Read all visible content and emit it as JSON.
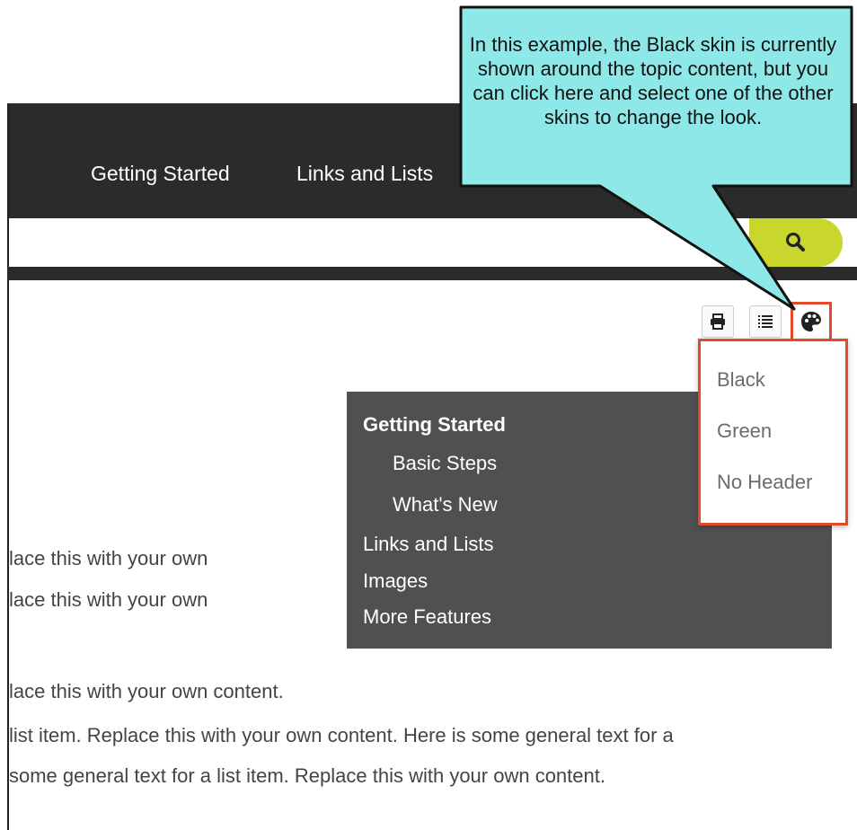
{
  "callout": {
    "text": "In this example, the Black skin is currently shown around the topic content, but you can click here and select one of the other skins to change the look."
  },
  "nav": {
    "links": [
      "Getting Started",
      "Links and Lists"
    ]
  },
  "search": {
    "placeholder": "",
    "button_icon": "search-icon",
    "accent_color": "#c8d62e"
  },
  "toolbar": {
    "print_icon": "print-icon",
    "toc_icon": "list-icon",
    "skin_icon": "palette-icon"
  },
  "skin_menu": {
    "items": [
      "Black",
      "Green",
      "No Header"
    ],
    "highlight_color": "#e24a2c"
  },
  "toc": {
    "items": [
      {
        "label": "Getting Started"
      },
      {
        "label": "Basic Steps"
      },
      {
        "label": "What's New"
      },
      {
        "label": "Links and Lists"
      },
      {
        "label": "Images"
      },
      {
        "label": "More Features"
      }
    ]
  },
  "content": {
    "lines": [
      "lace this with your own",
      "lace this with your own",
      "lace this with your own content.",
      "list item. Replace this with your own content. Here is some general text for a",
      "some general text for a list item. Replace this with your own content."
    ]
  }
}
